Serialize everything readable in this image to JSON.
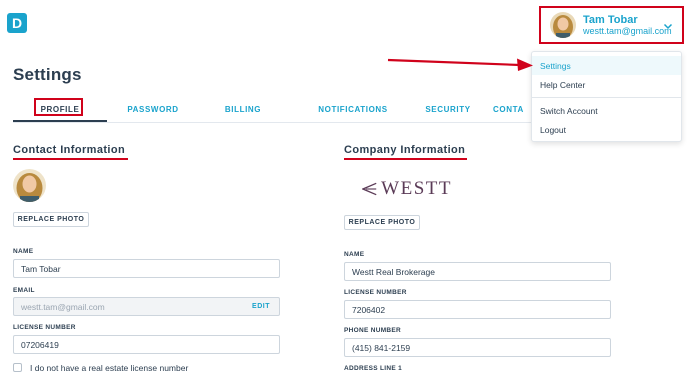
{
  "app": {
    "logo_letter": "D"
  },
  "user": {
    "name": "Tam Tobar",
    "email": "westt.tam@gmail.com"
  },
  "page": {
    "title": "Settings"
  },
  "tabs": [
    "PROFILE",
    "PASSWORD",
    "BILLING",
    "NOTIFICATIONS",
    "SECURITY",
    "CONTA"
  ],
  "contact": {
    "title": "Contact Information",
    "replace_photo": "REPLACE PHOTO",
    "name_label": "NAME",
    "name_value": "Tam Tobar",
    "email_label": "EMAIL",
    "email_value": "westt.tam@gmail.com",
    "edit_label": "EDIT",
    "license_label": "LICENSE NUMBER",
    "license_value": "07206419",
    "no_license_label": "I do not have a real estate license number"
  },
  "company": {
    "title": "Company Information",
    "logo_text": "WESTT",
    "replace_photo": "REPLACE PHOTO",
    "name_label": "NAME",
    "name_value": "Westt Real Brokerage",
    "license_label": "LICENSE NUMBER",
    "license_value": "7206402",
    "phone_label": "PHONE NUMBER",
    "phone_value": "(415) 841-2159",
    "address_label": "ADDRESS LINE 1"
  },
  "dropdown": {
    "items": [
      "Settings",
      "Help Center",
      "Switch Account",
      "Logout"
    ]
  },
  "colors": {
    "accent": "#1aa3cc",
    "annotation": "#d0021b",
    "text": "#2c3e50"
  }
}
